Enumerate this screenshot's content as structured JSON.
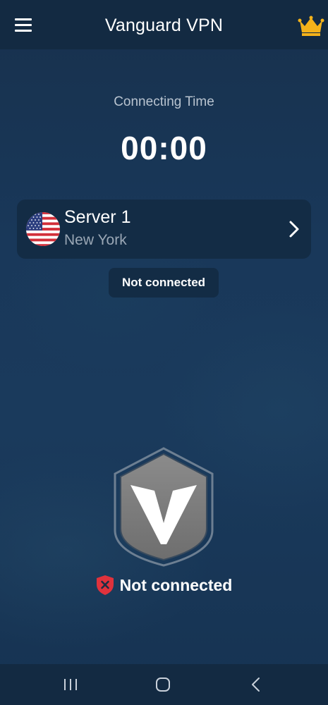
{
  "header": {
    "title": "Vanguard VPN",
    "menu_icon": "hamburger-menu-icon",
    "premium_icon": "crown-icon"
  },
  "timer": {
    "label": "Connecting Time",
    "value": "00:00"
  },
  "server": {
    "name": "Server 1",
    "location": "New York",
    "flag_icon": "us-flag-icon"
  },
  "status_pill": {
    "text": "Not connected"
  },
  "connection": {
    "status_text": "Not connected",
    "status_icon": "shield-x-icon"
  },
  "colors": {
    "background": "#173453",
    "bar": "#132a42",
    "card": "#132c45",
    "crown": "#f4b21a",
    "error": "#e0323c"
  }
}
